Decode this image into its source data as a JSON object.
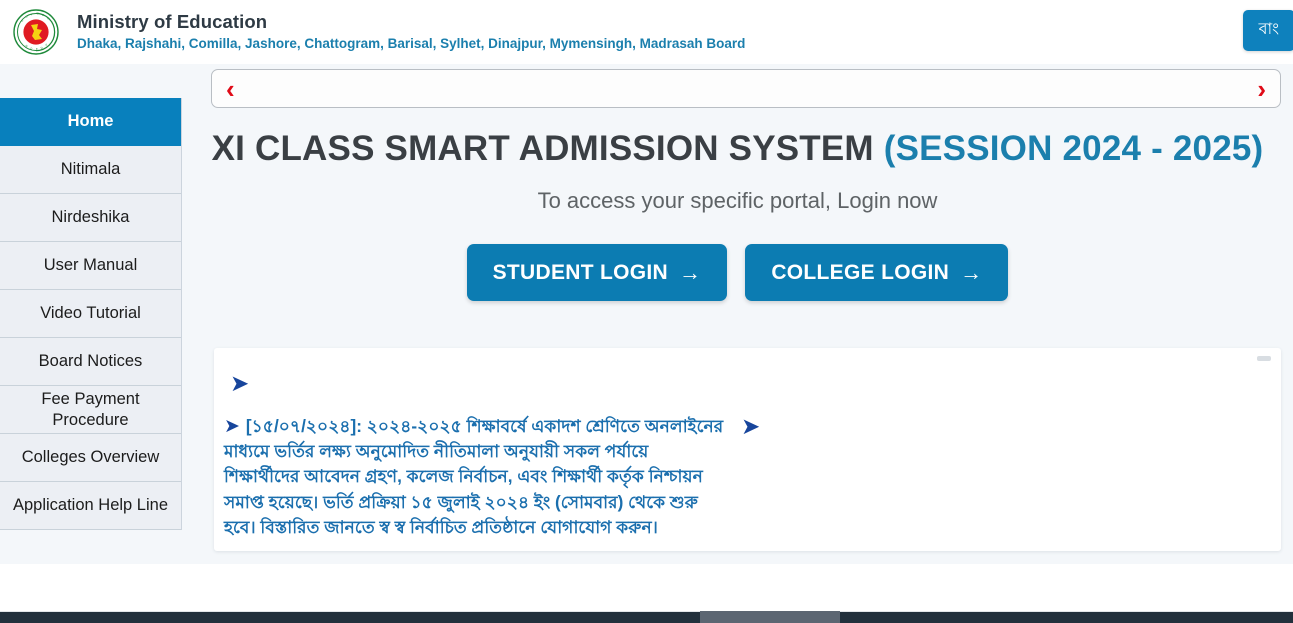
{
  "header": {
    "logo_alt": "Government of Bangladesh seal",
    "title": "Ministry of Education",
    "boards": "Dhaka, Rajshahi, Comilla, Jashore, Chattogram, Barisal, Sylhet, Dinajpur, Mymensingh, Madrasah Board",
    "lang_button": "বাং"
  },
  "carousel": {
    "prev": "‹",
    "next": "›"
  },
  "sidebar": {
    "items": [
      {
        "label": "Home",
        "active": true
      },
      {
        "label": "Nitimala",
        "active": false
      },
      {
        "label": "Nirdeshika",
        "active": false
      },
      {
        "label": "User Manual",
        "active": false
      },
      {
        "label": "Video Tutorial",
        "active": false
      },
      {
        "label": "Board Notices",
        "active": false
      },
      {
        "label": "Fee Payment Procedure",
        "active": false
      },
      {
        "label": "Colleges Overview",
        "active": false
      },
      {
        "label": "Application Help Line",
        "active": false
      }
    ]
  },
  "hero": {
    "title_main": "XI CLASS SMART ADMISSION SYSTEM",
    "title_session": "(SESSION 2024 - 2025)",
    "subtitle": "To access your specific portal, Login now",
    "student_login": "STUDENT LOGIN",
    "college_login": "COLLEGE LOGIN",
    "arrow": "→"
  },
  "notice": {
    "marker": "➤",
    "text": "[১৫/০৭/২০২৪]: ২০২৪-২০২৫ শিক্ষাবর্ষে একাদশ শ্রেণিতে অনলাইনের মাধ্যমে ভর্তির লক্ষ্য অনুমোদিত নীতিমালা অনুযায়ী সকল পর্যায়ে শিক্ষার্থীদের আবেদন গ্রহণ, কলেজ নির্বাচন, এবং শিক্ষার্থী কর্তৃক নিশ্চায়ন সমাপ্ত হয়েছে। ভর্তি প্রক্রিয়া ১৫ জুলাই ২০২৪ ইং (সোমবার) থেকে শুরু হবে। বিস্তারিত জানতে স্ব স্ব নির্বাচিত প্রতিষ্ঠানে যোগাযোগ করুন।"
  },
  "colors": {
    "accent_blue": "#0c7cb2",
    "sidebar_active": "#0880bd",
    "notice_text": "#1b6fae",
    "marker_navy": "#17459c",
    "chevron_red": "#e00b18",
    "page_bg": "#f4f7fa",
    "footer_dark": "#22303c"
  }
}
